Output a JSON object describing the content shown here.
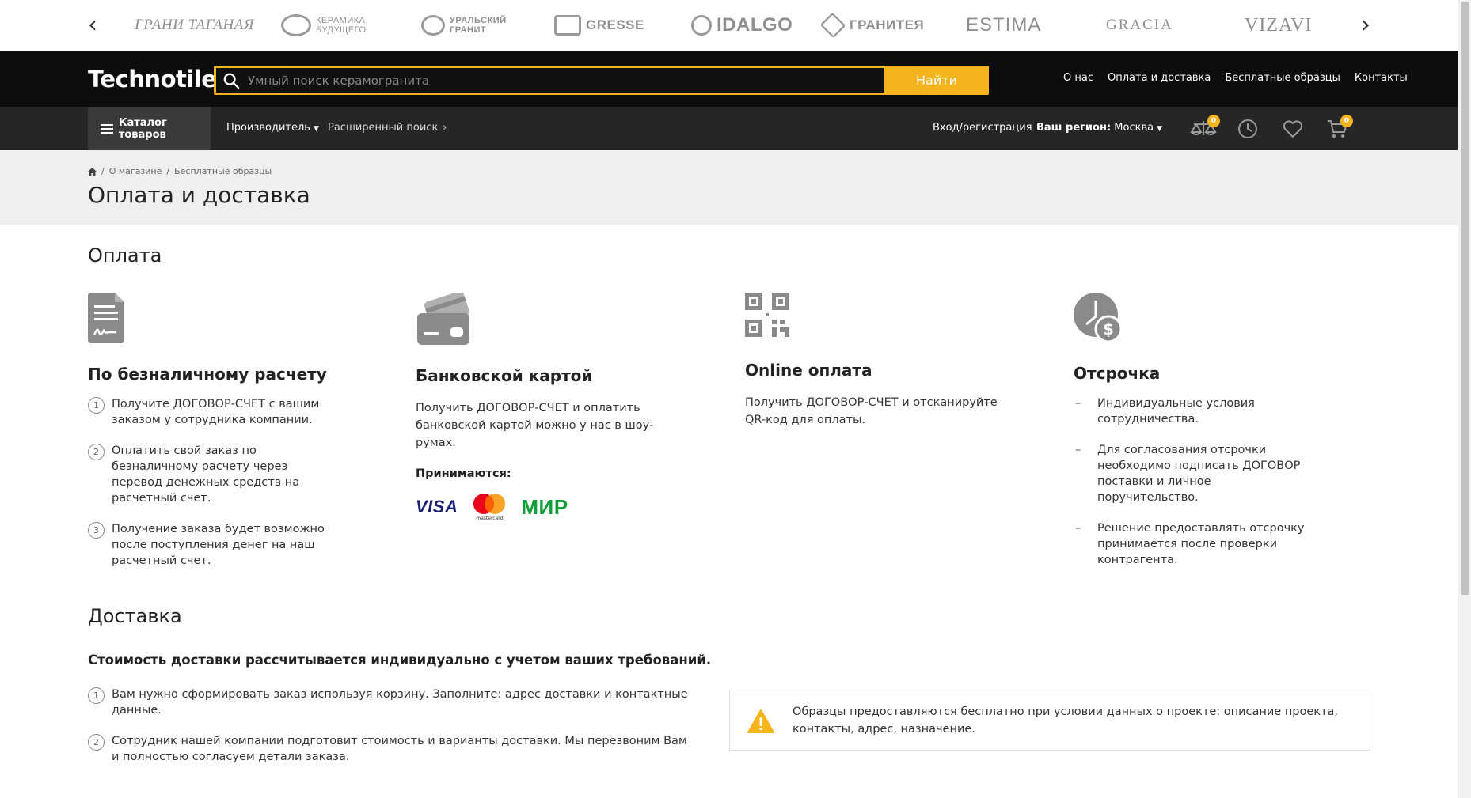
{
  "brands": [
    {
      "name": "ГРАНИ ТАГАНАЯ"
    },
    {
      "name": "КЕРАМИКА БУДУЩЕГО"
    },
    {
      "name": "УРАЛЬСКИЙ ГРАНИТ"
    },
    {
      "name": "GRESSE"
    },
    {
      "name": "IDALGO"
    },
    {
      "name": "ГРАНИТЕЯ"
    },
    {
      "name": "ESTIMA"
    },
    {
      "name": "GRACIA"
    },
    {
      "name": "VIZAVI"
    }
  ],
  "header": {
    "logo": "Technotile",
    "search_placeholder": "Умный поиск керамогранита",
    "search_button": "Найти",
    "links": [
      "О нас",
      "Оплата и доставка",
      "Бесплатные образцы",
      "Контакты"
    ]
  },
  "nav": {
    "catalog": "Каталог товаров",
    "manufacturer": "Производитель",
    "advanced_search": "Расширенный поиск",
    "login": "Вход/регистрация",
    "region_label": "Ваш регион:",
    "region_value": "Москва",
    "compare_count": "0",
    "cart_count": "0"
  },
  "breadcrumb": [
    "О магазине",
    "Бесплатные образцы"
  ],
  "page_title": "Оплата и доставка",
  "payment": {
    "title": "Оплата",
    "cashless": {
      "title": "По безналичному расчету",
      "steps": [
        "Получите ДОГОВОР-СЧЕТ с вашим заказом у сотрудника компании.",
        "Оплатить свой заказ по безналичному расчету через перевод денежных средств на расчетный счет.",
        "Получение заказа будет возможно после поступления денег на наш расчетный счет."
      ]
    },
    "card": {
      "title": "Банковской картой",
      "text": "Получить ДОГОВОР-СЧЕТ и оплатить банковской картой можно у нас в шоу-румах.",
      "accepted": "Принимаются:",
      "visa": "VISA",
      "mastercard": "mastercard",
      "mir": "МИР"
    },
    "online": {
      "title": "Online оплата",
      "text": "Получить ДОГОВОР-СЧЕТ и отсканируйте QR-код для оплаты."
    },
    "deferral": {
      "title": "Отсрочка",
      "items": [
        "Индивидуальные условия сотрудничества.",
        "Для согласования отсрочки необходимо подписать ДОГОВОР поставки и личное поручительство.",
        "Решение предоставлять отсрочку принимается после проверки контрагента."
      ]
    }
  },
  "delivery": {
    "title": "Доставка",
    "lead": "Стоимость доставки рассчитывается индивидуально с учетом ваших требований.",
    "steps": [
      "Вам нужно сформировать заказ используя корзину. Заполните: адрес доставки и контактные данные.",
      "Сотрудник нашей компании подготовит стоимость и варианты доставки. Мы перезвоним Вам и полностью согласуем детали заказа."
    ],
    "notice": "Образцы предоставляются бесплатно при условии данных о проекте: описание проекта, контакты, адрес, назначение."
  },
  "colors": {
    "accent": "#f5b31c",
    "header_bg": "#0d0d0d",
    "nav_bg": "#262626",
    "icon_gray": "#8a8a8a"
  }
}
